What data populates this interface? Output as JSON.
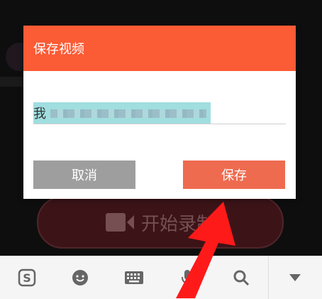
{
  "dialog": {
    "title": "保存视频",
    "field_value": "我",
    "cancel_label": "取消",
    "save_label": "保存"
  },
  "record_button": {
    "label": "开始录制"
  },
  "toolbar": {
    "items": [
      "sogou-logo-icon",
      "emoji-icon",
      "keyboard-icon",
      "voice-icon",
      "search-icon",
      "collapse-icon"
    ]
  },
  "colors": {
    "header": "#fb5b35",
    "save": "#ee6b4f",
    "cancel": "#9e9e9e",
    "record_bg": "#5c1f25",
    "arrow": "#ff1a1a"
  }
}
